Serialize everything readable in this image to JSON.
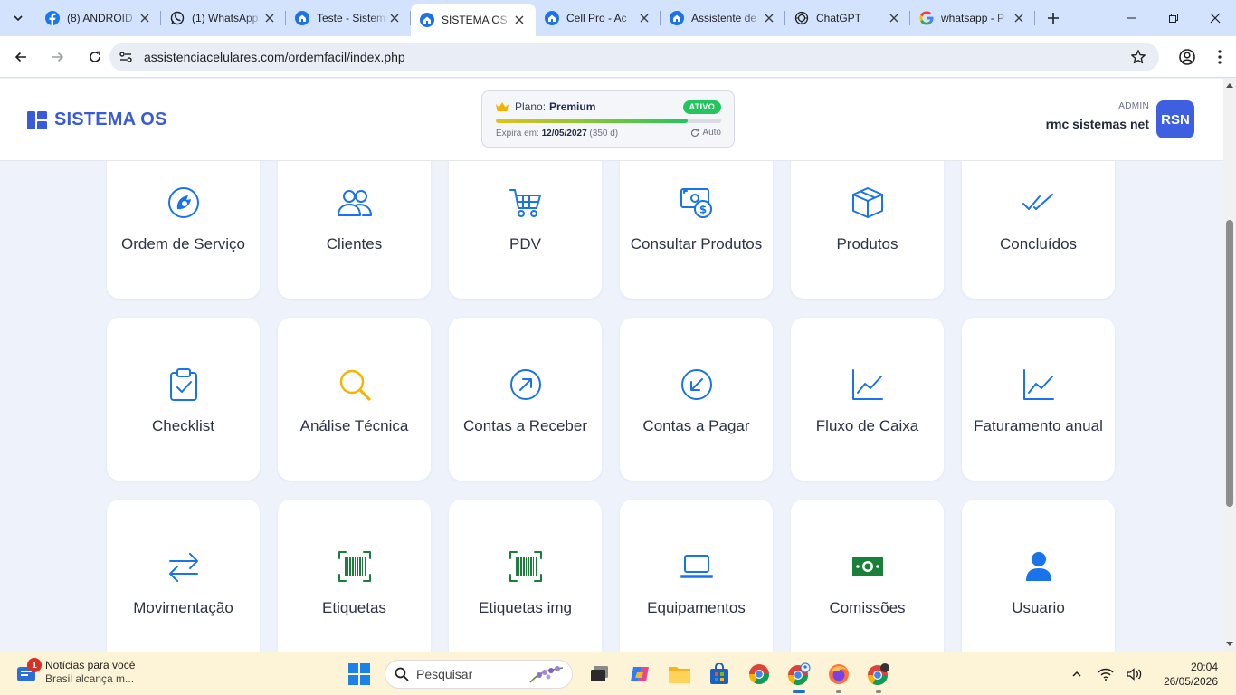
{
  "browser": {
    "tabs": [
      {
        "title": "(8) ANDROID",
        "icon": "facebook-icon"
      },
      {
        "title": "(1) WhatsApp",
        "icon": "whatsapp-icon"
      },
      {
        "title": "Teste - Sistema",
        "icon": "home-icon"
      },
      {
        "title": "SISTEMA OS",
        "icon": "home-icon",
        "active": true
      },
      {
        "title": "Cell Pro - Ac",
        "icon": "home-icon"
      },
      {
        "title": "Assistente de",
        "icon": "home-icon"
      },
      {
        "title": "ChatGPT",
        "icon": "chatgpt-icon"
      },
      {
        "title": "whatsapp - P",
        "icon": "google-icon"
      }
    ],
    "url": "assistenciacelulares.com/ordemfacil/index.php"
  },
  "header": {
    "brand": "SISTEMA OS",
    "plan": {
      "label": "Plano:",
      "name": "Premium",
      "status": "ATIVO",
      "expires_label": "Expira em:",
      "expires_date": "12/05/2027",
      "days_left": "(350 d)",
      "renew_label": "Auto",
      "progress_fraction": 0.85
    },
    "user": {
      "role": "ADMIN",
      "name": "rmc sistemas net",
      "initials": "RSN"
    }
  },
  "modules": [
    {
      "label": "Ordem de Serviço",
      "icon": "service-order-icon",
      "color": "#1a73e8"
    },
    {
      "label": "Clientes",
      "icon": "clients-icon",
      "color": "#1a73e8"
    },
    {
      "label": "PDV",
      "icon": "shopping-cart-icon",
      "color": "#1a73e8"
    },
    {
      "label": "Consultar Produtos",
      "icon": "product-lookup-icon",
      "color": "#1a73e8"
    },
    {
      "label": "Produtos",
      "icon": "box-icon",
      "color": "#1a73e8"
    },
    {
      "label": "Concluídos",
      "icon": "double-check-icon",
      "color": "#1a73e8"
    },
    {
      "label": "Checklist",
      "icon": "clipboard-check-icon",
      "color": "#1a73e8"
    },
    {
      "label": "Análise Técnica",
      "icon": "magnifier-icon",
      "color": "#f4b400"
    },
    {
      "label": "Contas a Receber",
      "icon": "arrow-up-right-circle-icon",
      "color": "#1a73e8"
    },
    {
      "label": "Contas a Pagar",
      "icon": "arrow-down-left-circle-icon",
      "color": "#1a73e8"
    },
    {
      "label": "Fluxo de Caixa",
      "icon": "line-chart-icon",
      "color": "#1a73e8"
    },
    {
      "label": "Faturamento anual",
      "icon": "line-chart-icon",
      "color": "#1a73e8"
    },
    {
      "label": "Movimentação",
      "icon": "arrows-left-right-icon",
      "color": "#1a73e8"
    },
    {
      "label": "Etiquetas",
      "icon": "barcode-icon",
      "color": "#188038"
    },
    {
      "label": "Etiquetas img",
      "icon": "barcode-icon",
      "color": "#188038"
    },
    {
      "label": "Equipamentos",
      "icon": "laptop-icon",
      "color": "#1a73e8"
    },
    {
      "label": "Comissões",
      "icon": "cash-icon",
      "color": "#188038"
    },
    {
      "label": "Usuario",
      "icon": "user-icon",
      "color": "#1a73e8"
    }
  ],
  "taskbar": {
    "news_title": "Notícias para você",
    "news_subtitle": "Brasil alcança m...",
    "news_badge": "1",
    "search_placeholder": "Pesquisar",
    "time": "20:04",
    "date": "26/05/2026"
  }
}
